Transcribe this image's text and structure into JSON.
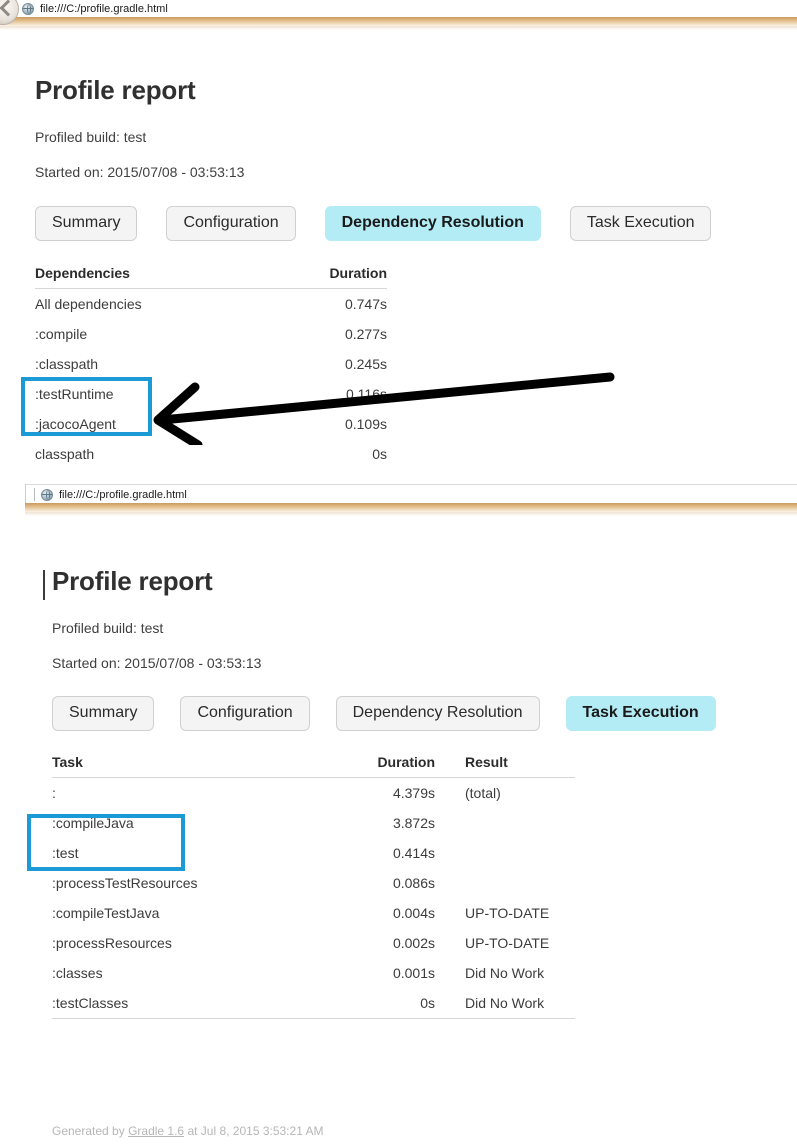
{
  "browser": {
    "url": "file:///C:/profile.gradle.html",
    "back_icon": "back-arrow-icon",
    "site_icon": "globe-icon"
  },
  "report_1": {
    "title": "Profile report",
    "profiled_build": "Profiled build: test",
    "started_on": "Started on: 2015/07/08 - 03:53:13",
    "tabs": [
      {
        "label": "Summary",
        "active": false
      },
      {
        "label": "Configuration",
        "active": false
      },
      {
        "label": "Dependency Resolution",
        "active": true
      },
      {
        "label": "Task Execution",
        "active": false
      }
    ],
    "table": {
      "headers": [
        "Dependencies",
        "Duration"
      ],
      "rows": [
        {
          "name": "All dependencies",
          "duration": "0.747s"
        },
        {
          "name": ":compile",
          "duration": "0.277s"
        },
        {
          "name": ":classpath",
          "duration": "0.245s"
        },
        {
          "name": ":testRuntime",
          "duration": "0.116s"
        },
        {
          "name": ":jacocoAgent",
          "duration": "0.109s"
        },
        {
          "name": "classpath",
          "duration": "0s"
        }
      ]
    }
  },
  "report_2": {
    "title": "Profile report",
    "profiled_build": "Profiled build: test",
    "started_on": "Started on: 2015/07/08 - 03:53:13",
    "tabs": [
      {
        "label": "Summary",
        "active": false
      },
      {
        "label": "Configuration",
        "active": false
      },
      {
        "label": "Dependency Resolution",
        "active": false
      },
      {
        "label": "Task Execution",
        "active": true
      }
    ],
    "table": {
      "headers": [
        "Task",
        "Duration",
        "Result"
      ],
      "rows": [
        {
          "name": ":",
          "duration": "4.379s",
          "result": "(total)"
        },
        {
          "name": ":compileJava",
          "duration": "3.872s",
          "result": ""
        },
        {
          "name": ":test",
          "duration": "0.414s",
          "result": ""
        },
        {
          "name": ":processTestResources",
          "duration": "0.086s",
          "result": ""
        },
        {
          "name": ":compileTestJava",
          "duration": "0.004s",
          "result": "UP-TO-DATE"
        },
        {
          "name": ":processResources",
          "duration": "0.002s",
          "result": "UP-TO-DATE"
        },
        {
          "name": ":classes",
          "duration": "0.001s",
          "result": "Did No Work"
        },
        {
          "name": ":testClasses",
          "duration": "0s",
          "result": "Did No Work"
        }
      ]
    }
  },
  "footer": {
    "prefix": "Generated by ",
    "link": "Gradle 1.6",
    "suffix": " at Jul 8, 2015 3:53:21 AM"
  },
  "annotations": {
    "highlight_color": "#1b9ad6",
    "arrow_color": "#000000",
    "box_1_targets": [
      ":testRuntime",
      ":jacocoAgent"
    ],
    "box_2_targets": [
      ":compileJava",
      ":test"
    ]
  },
  "colors": {
    "active_tab_bg": "#b3ecf5",
    "tab_bg": "#f4f4f4",
    "chrome_tan": "#c89a60"
  }
}
